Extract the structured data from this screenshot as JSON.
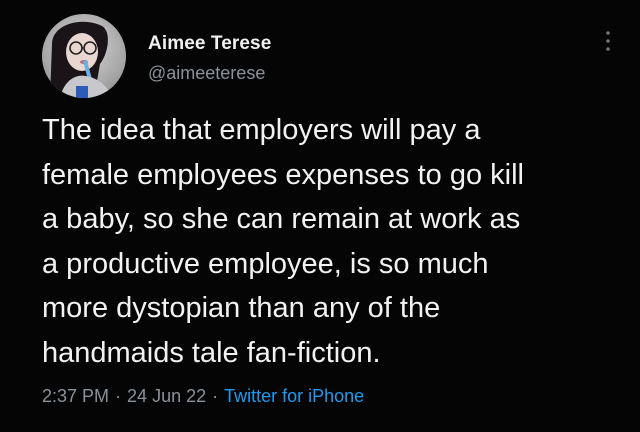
{
  "author": {
    "name": "Aimee Terese",
    "handle": "@aimeeterese"
  },
  "tweet": {
    "lines": [
      "The idea that employers will pay a",
      "female employees expenses to go kill",
      "a baby, so she can remain at work as",
      "a productive employee, is so much",
      "more dystopian than any of the",
      "handmaids tale fan-fiction."
    ]
  },
  "meta": {
    "time": "2:37 PM",
    "date": "24 Jun 22",
    "source": "Twitter for iPhone",
    "separator": "·"
  },
  "icons": {
    "more": "more-vertical-icon"
  },
  "colors": {
    "background": "#000000",
    "text": "#f2f2f2",
    "secondary": "#8b9198",
    "link": "#1d9bf0"
  }
}
